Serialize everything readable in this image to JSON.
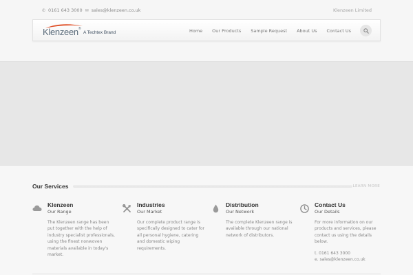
{
  "topbar": {
    "phone": "0161 643 3000",
    "email": "sales@klenzeen.co.uk",
    "company": "Klenzeen Limited"
  },
  "header": {
    "logo_text": "Klenzeen",
    "logo_reg": "®",
    "logo_tagline": "A Techtex Brand",
    "nav": [
      "Home",
      "Our Products",
      "Sample Request",
      "About Us",
      "Contact Us"
    ],
    "search_icon": "search-icon"
  },
  "services": {
    "title": "Our Services",
    "learn_more": "LEARN MORE",
    "items": [
      {
        "icon": "cloud-icon",
        "title": "Klenzeen",
        "subtitle": "Our Range",
        "body": "The Klenzeen range has been put together with the help of industry specialist professionals, using the finest nonwoven materials available in today's market."
      },
      {
        "icon": "tools-icon",
        "title": "Industries",
        "subtitle": "Our Market",
        "body": "Our complete product range is specifically designed to cater for all personal hygiene, catering and domestic wiping requirements."
      },
      {
        "icon": "drop-icon",
        "title": "Distribution",
        "subtitle": "Our Network",
        "body": "The complete Klenzeen range is available through our national network of distributors."
      },
      {
        "icon": "clock-icon",
        "title": "Contact Us",
        "subtitle": "Our Details",
        "body": "For more information on our products and services, please contact us using the details below.",
        "phone_line": "t. 0161 643 3000",
        "email_line": "e. sales@klenzeen.co.uk"
      }
    ]
  },
  "colors": {
    "accent_swoosh": "#e0522a",
    "logo_text": "#5a6b7a",
    "hero_bg": "#e7e7e7"
  }
}
